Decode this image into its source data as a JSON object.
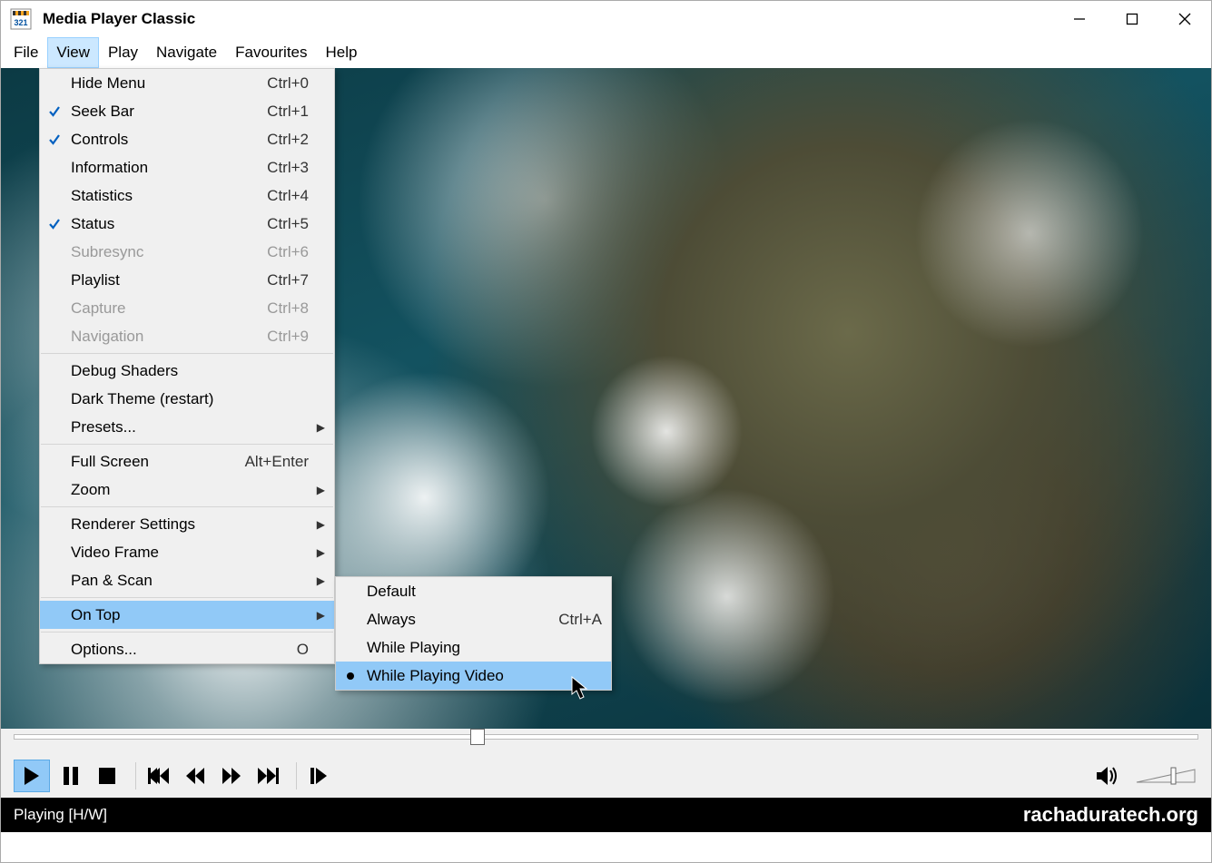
{
  "titlebar": {
    "title": "Media Player Classic"
  },
  "menubar": {
    "items": [
      {
        "label": "File"
      },
      {
        "label": "View"
      },
      {
        "label": "Play"
      },
      {
        "label": "Navigate"
      },
      {
        "label": "Favourites"
      },
      {
        "label": "Help"
      }
    ],
    "active_index": 1
  },
  "view_menu": {
    "groups": [
      [
        {
          "label": "Hide Menu",
          "accel": "Ctrl+0",
          "checked": false
        },
        {
          "label": "Seek Bar",
          "accel": "Ctrl+1",
          "checked": true
        },
        {
          "label": "Controls",
          "accel": "Ctrl+2",
          "checked": true
        },
        {
          "label": "Information",
          "accel": "Ctrl+3",
          "checked": false
        },
        {
          "label": "Statistics",
          "accel": "Ctrl+4",
          "checked": false
        },
        {
          "label": "Status",
          "accel": "Ctrl+5",
          "checked": true
        },
        {
          "label": "Subresync",
          "accel": "Ctrl+6",
          "disabled": true
        },
        {
          "label": "Playlist",
          "accel": "Ctrl+7",
          "checked": false
        },
        {
          "label": "Capture",
          "accel": "Ctrl+8",
          "disabled": true
        },
        {
          "label": "Navigation",
          "accel": "Ctrl+9",
          "disabled": true
        }
      ],
      [
        {
          "label": "Debug Shaders"
        },
        {
          "label": "Dark Theme (restart)"
        },
        {
          "label": "Presets...",
          "submenu": true
        }
      ],
      [
        {
          "label": "Full Screen",
          "accel": "Alt+Enter"
        },
        {
          "label": "Zoom",
          "submenu": true
        }
      ],
      [
        {
          "label": "Renderer Settings",
          "submenu": true
        },
        {
          "label": "Video Frame",
          "submenu": true
        },
        {
          "label": "Pan & Scan",
          "submenu": true
        }
      ],
      [
        {
          "label": "On Top",
          "submenu": true,
          "highlighted": true
        }
      ],
      [
        {
          "label": "Options...",
          "accel": "O"
        }
      ]
    ]
  },
  "ontop_submenu": {
    "items": [
      {
        "label": "Default"
      },
      {
        "label": "Always",
        "accel": "Ctrl+A"
      },
      {
        "label": "While Playing"
      },
      {
        "label": "While Playing Video",
        "highlighted": true,
        "radio": true
      }
    ]
  },
  "controls": {
    "buttons": [
      {
        "name": "play-button"
      },
      {
        "name": "pause-button"
      },
      {
        "name": "stop-button"
      },
      {
        "name": "divider"
      },
      {
        "name": "skip-back-button"
      },
      {
        "name": "rewind-button"
      },
      {
        "name": "forward-button"
      },
      {
        "name": "skip-forward-button"
      },
      {
        "name": "divider"
      },
      {
        "name": "step-button"
      }
    ]
  },
  "status": {
    "left": "Playing [H/W]",
    "right": "rachaduratech.org"
  },
  "seek": {
    "progress_percent": 38.5
  }
}
